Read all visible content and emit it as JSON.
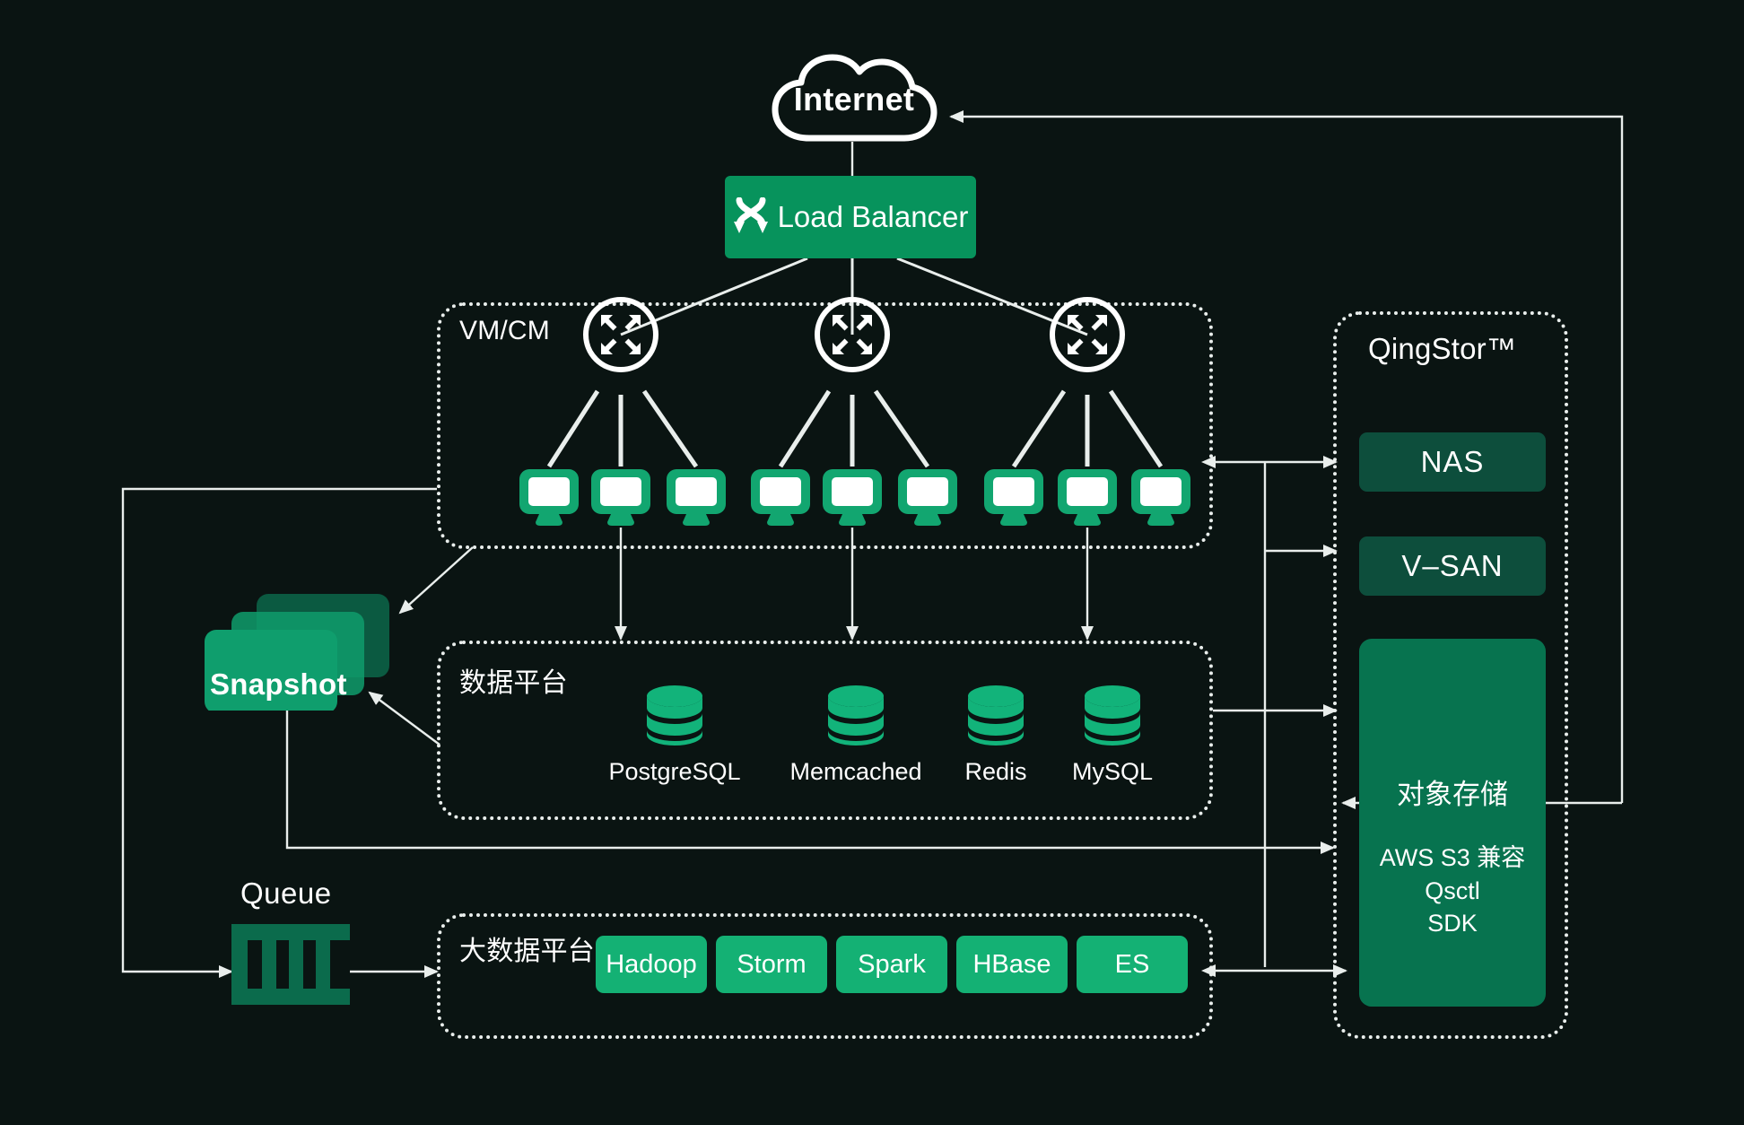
{
  "meta": {
    "title": "QingCloud architecture diagram",
    "background_color": "#0a1412",
    "accent_green": "#14b174",
    "deep_green": "#07734f",
    "dark_green": "#0d4e3c",
    "line_color": "#e9eeec"
  },
  "internet": {
    "label": "Internet",
    "icon": "cloud-icon"
  },
  "load_balancer": {
    "label": "Load Balancer",
    "icon": "load-balancer-icon"
  },
  "vm_cm": {
    "label": "VM/CM",
    "routers": [
      {
        "icon": "router-icon",
        "name": "router-1"
      },
      {
        "icon": "router-icon",
        "name": "router-2"
      },
      {
        "icon": "router-icon",
        "name": "router-3"
      }
    ],
    "hosts": [
      {
        "icon": "monitor-icon"
      },
      {
        "icon": "monitor-icon"
      },
      {
        "icon": "monitor-icon"
      },
      {
        "icon": "monitor-icon"
      },
      {
        "icon": "monitor-icon"
      },
      {
        "icon": "monitor-icon"
      },
      {
        "icon": "monitor-icon"
      },
      {
        "icon": "monitor-icon"
      },
      {
        "icon": "monitor-icon"
      }
    ]
  },
  "snapshot": {
    "label": "Snapshot",
    "icon": "stacked-cards-icon"
  },
  "queue": {
    "label": "Queue",
    "icon": "queue-icon"
  },
  "data_platform": {
    "label": "数据平台",
    "databases": [
      {
        "label": "PostgreSQL",
        "icon": "database-icon"
      },
      {
        "label": "Memcached",
        "icon": "database-icon"
      },
      {
        "label": "Redis",
        "icon": "database-icon"
      },
      {
        "label": "MySQL",
        "icon": "database-icon"
      }
    ]
  },
  "big_data_platform": {
    "label": "大数据平台",
    "components": [
      {
        "label": "Hadoop"
      },
      {
        "label": "Storm"
      },
      {
        "label": "Spark"
      },
      {
        "label": "HBase"
      },
      {
        "label": "ES"
      }
    ]
  },
  "qingstor": {
    "label": "QingStor™",
    "services": [
      {
        "label": "NAS"
      },
      {
        "label": "V–SAN"
      }
    ],
    "object_storage": {
      "title": "对象存储",
      "features": "AWS S3 兼容\nQsctl\nSDK",
      "feature_lines": [
        "AWS S3 兼容",
        "Qsctl",
        "SDK"
      ]
    }
  }
}
